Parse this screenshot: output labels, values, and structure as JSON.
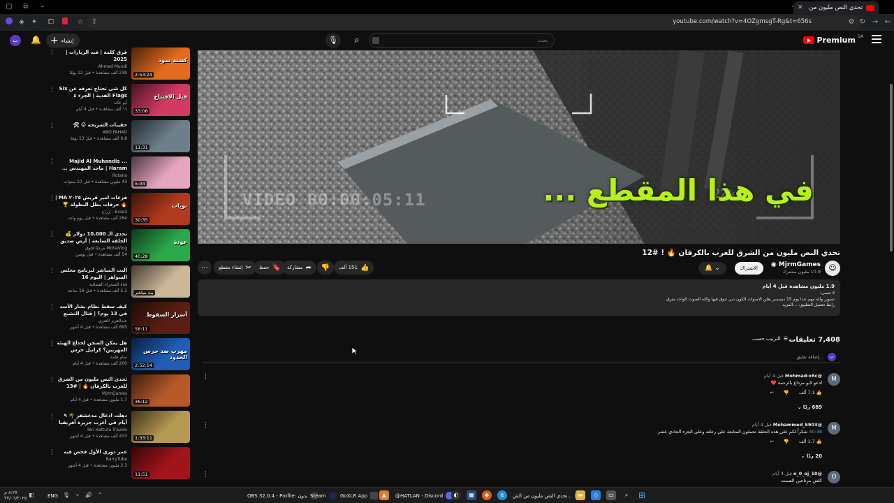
{
  "browser": {
    "tab_title": "تحدي النص مليون من الشرق للغ...",
    "url": "youtube.com/watch?v=4OZgmsgT-Rg&t=656s"
  },
  "header": {
    "logo_text": "Premium",
    "logo_region": "SA",
    "search_placeholder": "بحث",
    "create_label": "إنشاء",
    "avatar_letter": "ب"
  },
  "recommendations": [
    {
      "title": "فرق كلمة | فيد الزيارات | 2025",
      "channel": "Ahmed Mundi",
      "meta": "239 ألف مشاهدة • قبل 12 يومًا",
      "duration": "2:53:24",
      "thumb_color": "#e46b1c",
      "thumb_text": "كشتة نمود"
    },
    {
      "title": "كل شي تحتاج تعرفه عن Six Flags القدية | الجزء ٤",
      "channel": "أبو خالد",
      "meta": "٦٦ ألف مشاهدة • قبل 4 أيام",
      "duration": "33:06",
      "thumb_color": "#d23a62",
      "thumb_text": "قبل الافتتاح"
    },
    {
      "title": "حقيبات الشريحة 😡 🛠",
      "channel": "ABO FAHAD",
      "meta": "6.8 ألف مشاهدة • قبل 13 يومًا",
      "duration": "11:31",
      "thumb_color": "#6e7f8c",
      "thumb_text": ""
    },
    {
      "title": "Majid Al Muhandis ... Haram | ماجد المهندس ... حرام",
      "channel": "Rotana",
      "meta": "43 مليون مشاهدة • قبل 10 سنوات",
      "duration": "5:04",
      "thumb_color": "#e7a6c0",
      "thumb_text": ""
    },
    {
      "title": "فزعات امير قريش ٢٠٢٥ MA | 🔥 حرفات بطل البطولة 🏆",
      "channel": "Eraa3 - إرزاع",
      "meta": "264 ألف مشاهدة • قبل يوم واحد",
      "duration": "30:35",
      "thumb_color": "#b03a1e",
      "thumb_text": "نوبات"
    },
    {
      "title": "تحدي الـ 10.000 دولار 💰 الحلقة السابعة | أرض صديق 👑",
      "channel": "MohaVlog مرحبًا فلوق",
      "meta": "54 ألف مشاهدة • قبل يومين",
      "duration": "40:28",
      "thumb_color": "#2ba84a",
      "thumb_text": "عودة"
    },
    {
      "title": "البث المباشر لبرنامج مجلس السواهر | اليوم 16",
      "channel": "قناة الصحراء الفضائية",
      "meta": "5.2 ألف مشاهدة • قبل 16 ساعة",
      "duration": "بث مباشر",
      "thumb_color": "#cdb89a",
      "thumb_text": ""
    },
    {
      "title": "كيف سقط نظام بشار الأسد في 13 يوم؟ | قتال التشبع في حلب وحمص لأول مرة بالتفاصيل الكامل",
      "channel": "عبدالعزيز العنزي",
      "meta": "895 ألف مشاهدة • قبل 4 أشهر",
      "duration": "58:11",
      "thumb_color": "#5a1e12",
      "thumb_text": "أسرار السقوط"
    },
    {
      "title": "هل يمكن السجن لخداع الهيئة المهربين؟ كرانيل حرس الحدود | مع عبدالله رابوتي",
      "channel": "تمام هامة",
      "meta": "200 ألف مشاهدة • قبل 4 أيام",
      "duration": "2:52:14",
      "thumb_color": "#1f5db6",
      "thumb_text": "مهرب ضد حرس الحدود"
    },
    {
      "title": "تحدي النص مليون من الشرق للغرب بالكرفان 🔥 | #13",
      "channel": "MjrmGames",
      "meta": "1.7 مليون مشاهدة • قبل 4 أيام",
      "duration": "36:12",
      "thumb_color": "#b65a2a",
      "thumb_text": ""
    },
    {
      "title": "دهلت ادغال مدغشقر 🌴 ٩ أيام في أغرب جزيرة أفريقيا 🇲🇬 الرحلة كاملة",
      "channel": "Ibn Hattuta Travels",
      "meta": "433 ألف مشاهدة • قبل 4 أشهر",
      "duration": "1:33:11",
      "thumb_color": "#b79a52",
      "thumb_text": ""
    },
    {
      "title": "عمر دوري الأول فحص فيه",
      "channel": "BarryTube",
      "meta": "2.3 مليون مشاهدة • قبل 4 أشهر",
      "duration": "11:51",
      "thumb_color": "#a0141c",
      "thumb_text": ""
    }
  ],
  "player": {
    "overlay_text": "في هذا المقطع ...",
    "rec_timestamp": "VIDEO 00:00:05:11",
    "rec_percent": "22%"
  },
  "video": {
    "title": "تحدي النص مليون من الشرق للغرب بالكرفان 🔥 ! #12",
    "channel_name": "MjrmGames",
    "channel_subs": "10.9 مليون مشترك",
    "join_label": "الاشتراك",
    "like_count": "151 ألف",
    "share_label": "مشاركة",
    "save_label": "حفظ",
    "clip_label": "إنشاء مقطع"
  },
  "description": {
    "stats": "1.9 مليون مشاهدة  قبل 4 أيام",
    "line1": "لا تنسى:",
    "line2": "تصوير ولله مهم جدا يوم 15 ديسمبر يعلن الاصوات الكون دبي تنوق فيها والله الصوت الواحد يفرق",
    "line3": "رابط تحميل التطبيق: ...المزيد"
  },
  "comments_section": {
    "count": "7,408 تعليقات",
    "sort_label": "الترتيب حسب",
    "add_placeholder": "إضافة تعليق...",
    "avatar_letter": "ب"
  },
  "comments": [
    {
      "author": "@Mohmad-x6c",
      "time": "قبل 4 أيام",
      "text": "ادعو لابو مرداع بالرحمة ❤️",
      "likes": "7.1 ألف",
      "replies": "689 ردًا",
      "avatar": "M",
      "timestamp": ""
    },
    {
      "author": "@Mohammed_k903",
      "time": "قبل 4 أيام",
      "text": "شكراً لكم على هذه الحلقة تحملون المتابعة على رحلته وعلى الجزء الحادي عشر",
      "likes": "1.7 ألف",
      "replies": "20 ردًا",
      "avatar": "M",
      "timestamp": "40:38"
    },
    {
      "author": "@o_0_oj_10",
      "time": "قبل 4 أيام",
      "text": "كلش مرتاحين الصمت",
      "likes": "",
      "replies": "",
      "avatar": "O",
      "timestamp": ""
    }
  ],
  "taskbar": {
    "obs": "OBS 32.0.4 - Profile: بدون",
    "steam": "Steam",
    "goxlr": "GoXLR App",
    "discord": "@HATLAN - Discord",
    "chrome_window": "تحدي النص مليون من الش...",
    "lang": "ENG",
    "clock_time": "٨:٢٧ م",
    "clock_date": "٢٧/٠٦/٢٠٢٥"
  },
  "colors": {
    "background": "#0f0f0f",
    "accent_red": "#ff0000",
    "overlay_green": "#b7f01a",
    "link_blue": "#3ea6ff"
  }
}
